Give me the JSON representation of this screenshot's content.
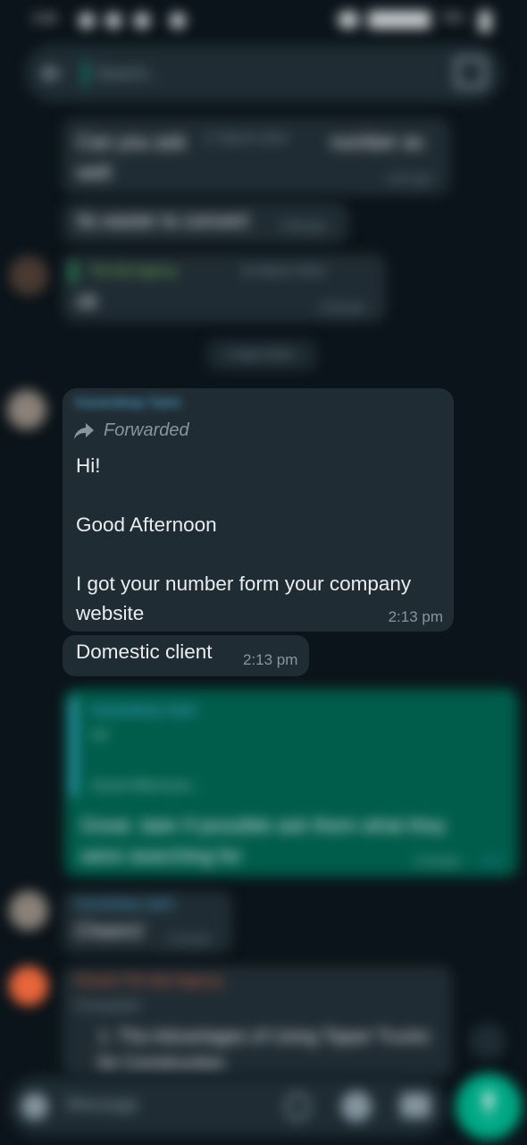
{
  "statusbar": {
    "time": "3:58",
    "battery": "78%"
  },
  "search": {
    "placeholder": "Search..."
  },
  "messages": {
    "top1_text": "Can you ask",
    "top1_date": "17 March 2024",
    "top1_text_b": "number as",
    "top1_text_c": "well",
    "top1_time": "1:57 pm",
    "top2_text": "Its easier to convert",
    "top2_time": "2:00 pm",
    "quote_sender": "The Bot Agency",
    "quote_date": "24 March 2024",
    "ok_text": "ok",
    "ok_time": "2:03 pm",
    "date_chip": "3 April 2024",
    "main": {
      "sender": "Karandeep Saini",
      "forwarded_label": "Forwarded",
      "text": "Hi!\n\nGood Afternoon\n\nI got your number form your company website",
      "time": "2:13 pm"
    },
    "domestic": {
      "text": "Domestic client",
      "time": "2:13 pm"
    },
    "reply": {
      "quoted_sender": "Karandeep Saini",
      "quoted_line1": "Hi!",
      "quoted_line2": "Good Afternoon...",
      "text": "Great. later if possible ask them what they were searching for",
      "time": "2:14 pm"
    },
    "cheers": {
      "sender": "Karandeep Saini",
      "text": "Cheers!",
      "time": "2:15 pm"
    },
    "bottom": {
      "sender": "Khushi The Bot Agency",
      "forwarded_label": "Forwarded",
      "text": "1. The Advantages of Using Tipper Trucks for Construction"
    }
  },
  "composer": {
    "placeholder": "Message"
  },
  "colors": {
    "accent": "#00a884",
    "bubble_in": "#202c33",
    "bubble_out": "#005c4b",
    "link_blue": "#53bdeb"
  }
}
